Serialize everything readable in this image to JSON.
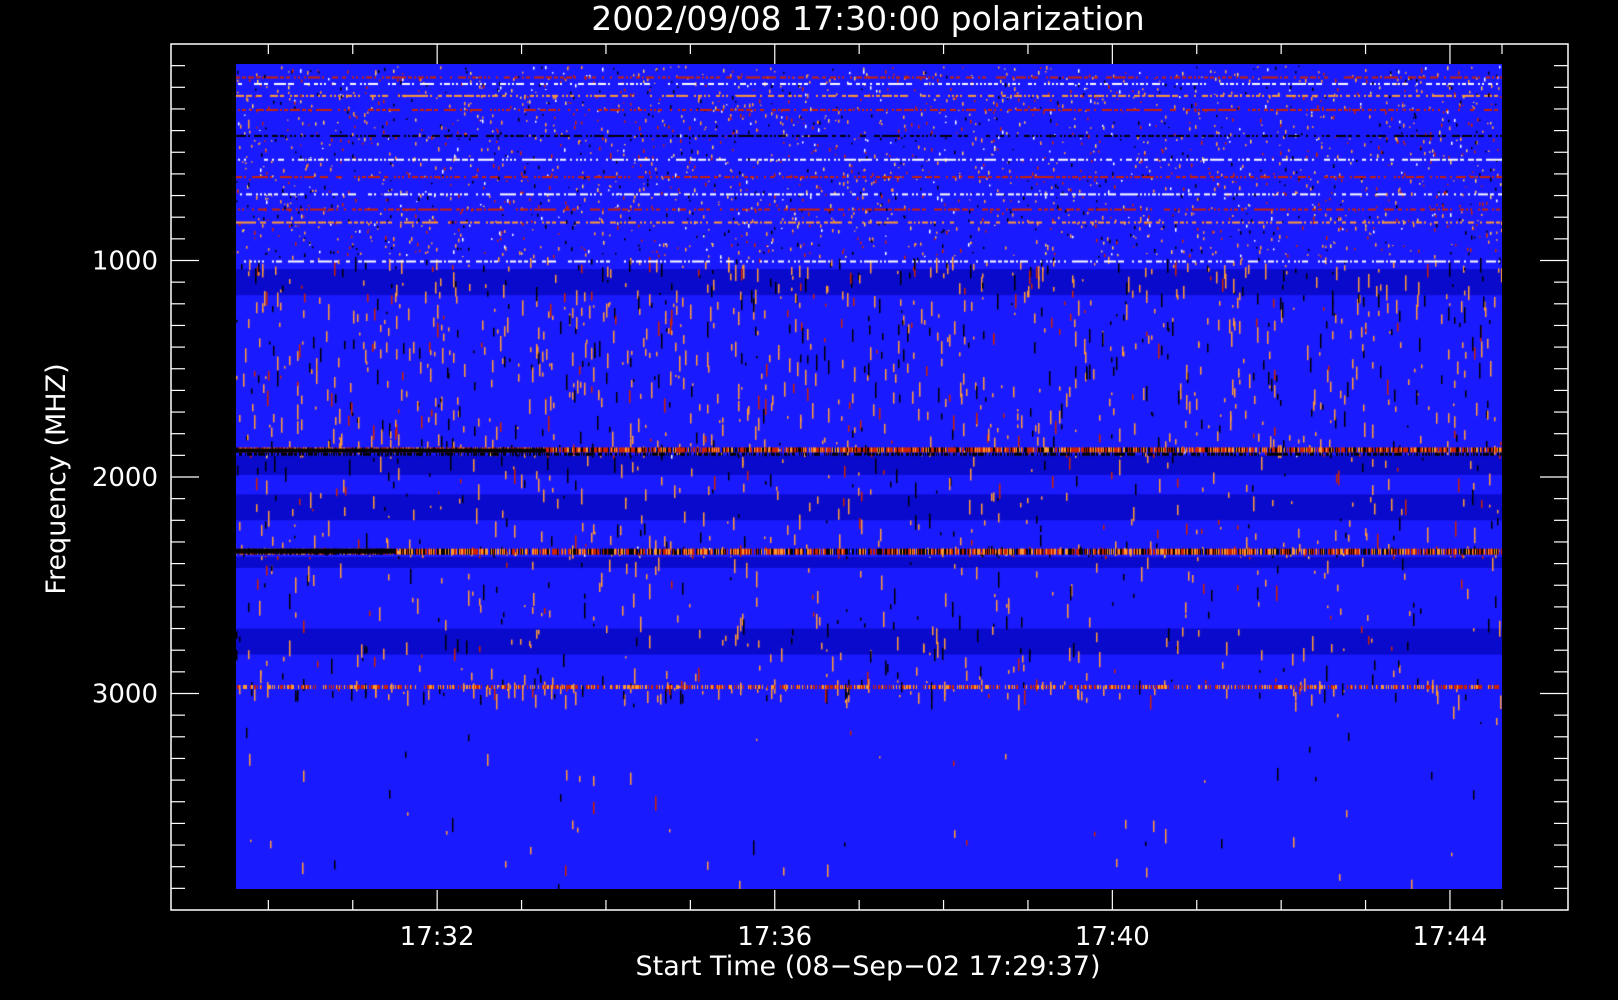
{
  "chart_data": {
    "type": "heatmap",
    "title": "2002/09/08 17:30:00 polarization",
    "xlabel": "Start Time (08−Sep−02 17:29:37)",
    "ylabel": "Frequency (MHZ)",
    "x_range": [
      "17:29:37",
      "17:44:37"
    ],
    "y_range": [
      0,
      4000
    ],
    "y_inverted": true,
    "data_extent": {
      "time_start": "17:29:37",
      "time_end": "17:44:37",
      "freq_min": 100,
      "freq_max": 3970
    },
    "x_ticks": [
      "17:32",
      "17:36",
      "17:40",
      "17:44"
    ],
    "y_ticks": [
      1000,
      2000,
      3000
    ],
    "grid": false,
    "colors": {
      "background": "#000000",
      "axes": "#ffffff",
      "base": "#1a1aff",
      "dark": "#0a0acc",
      "black": "#000000",
      "orange": "#ff9933",
      "red": "#cc2200",
      "yellow": "#ffcc55",
      "white": "#ffffff"
    },
    "bands": [
      {
        "freq_from": 100,
        "freq_to": 980,
        "description": "dense mixed noise",
        "intensity": 0.85
      },
      {
        "freq_from": 980,
        "freq_to": 1040,
        "description": "noise band",
        "intensity": 0.55
      },
      {
        "freq_from": 1040,
        "freq_to": 1860,
        "description": "orange streak region",
        "intensity": 0.35
      },
      {
        "freq_from": 1860,
        "freq_to": 1900,
        "description": "strong red/orange line",
        "intensity": 0.9
      },
      {
        "freq_from": 1900,
        "freq_to": 2320,
        "description": "moderate streaks",
        "intensity": 0.2
      },
      {
        "freq_from": 2320,
        "freq_to": 2370,
        "description": "red/black line",
        "intensity": 0.9
      },
      {
        "freq_from": 2370,
        "freq_to": 2930,
        "description": "sparse streaks",
        "intensity": 0.15
      },
      {
        "freq_from": 2930,
        "freq_to": 3010,
        "description": "red/orange line",
        "intensity": 0.55
      },
      {
        "freq_from": 3010,
        "freq_to": 3920,
        "description": "mostly quiet",
        "intensity": 0.02
      },
      {
        "freq_from": 3920,
        "freq_to": 3970,
        "description": "bottom noise edge",
        "intensity": 0.45
      }
    ]
  }
}
